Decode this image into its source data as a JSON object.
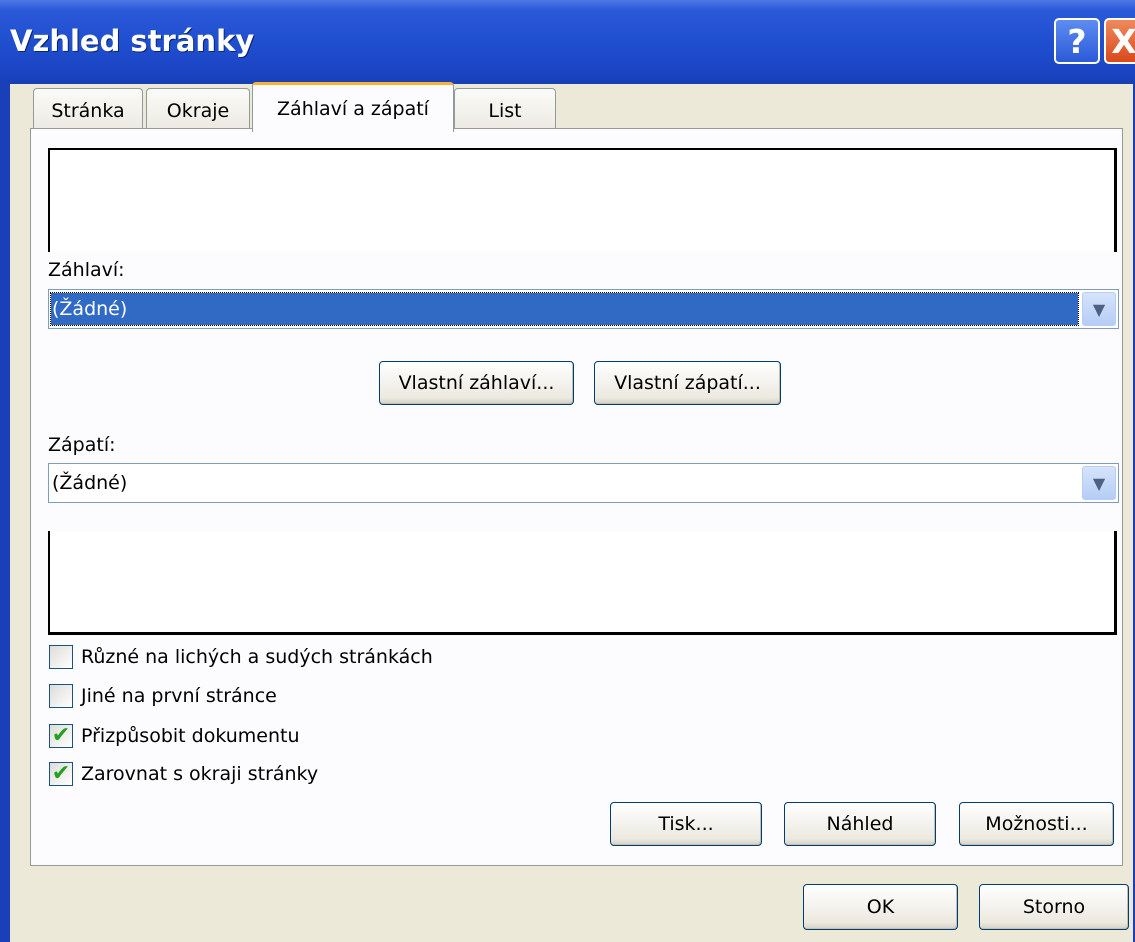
{
  "window": {
    "title": "Vzhled stránky",
    "help_glyph": "?",
    "close_glyph": "X"
  },
  "tabs": [
    {
      "label": "Stránka"
    },
    {
      "label": "Okraje"
    },
    {
      "label": "Záhlaví a zápatí",
      "active": true
    },
    {
      "label": "List"
    }
  ],
  "header": {
    "label": "Záhlaví:",
    "value": "(Žádné)"
  },
  "buttons": {
    "custom_header": "Vlastní záhlaví...",
    "custom_footer": "Vlastní zápatí...",
    "print": "Tisk...",
    "preview": "Náhled",
    "options": "Možnosti...",
    "ok": "OK",
    "cancel": "Storno"
  },
  "footer": {
    "label": "Zápatí:",
    "value": "(Žádné)"
  },
  "checkboxes": [
    {
      "label": "Různé na lichých a sudých stránkách",
      "checked": false
    },
    {
      "label": "Jiné na první stránce",
      "checked": false
    },
    {
      "label": "Přizpůsobit dokumentu",
      "checked": true
    },
    {
      "label": "Zarovnat s okraji stránky",
      "checked": true
    }
  ],
  "icons": {
    "dropdown_arrow": "chevron-down-icon",
    "check_mark": "✔"
  },
  "colors": {
    "titlebar": "#1f4fcf",
    "selection": "#316ac5",
    "active_tab_accent": "#f8b334",
    "dialog_bg": "#ece9d8"
  }
}
